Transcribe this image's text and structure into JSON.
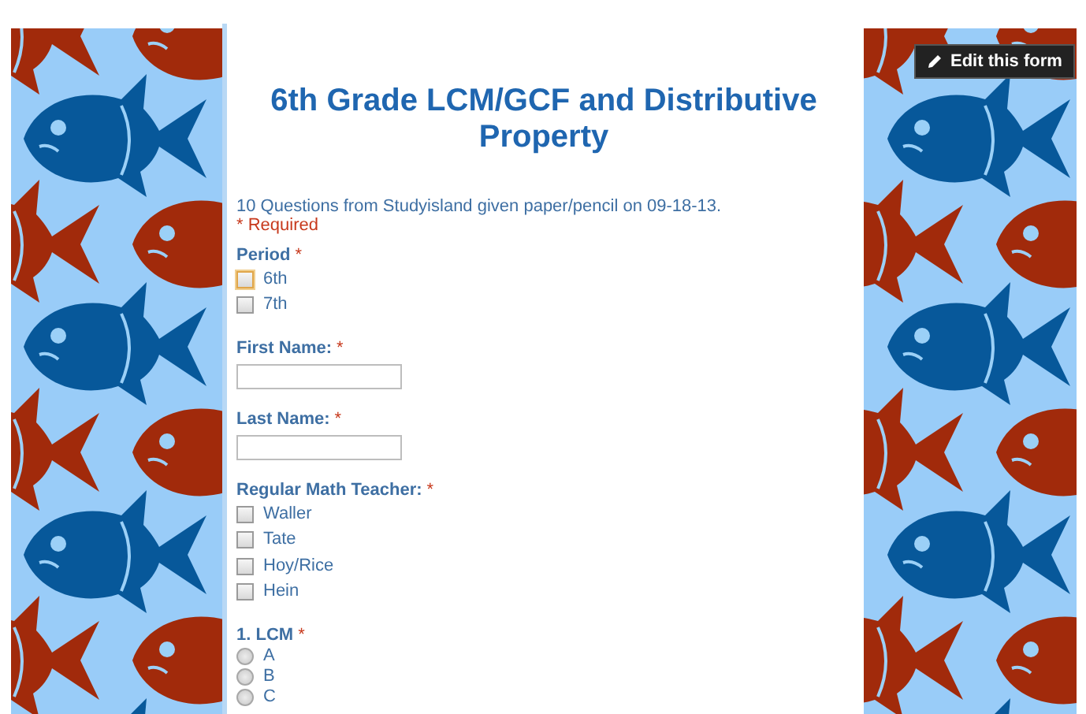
{
  "edit_button": {
    "label": "Edit this form"
  },
  "form": {
    "title": "6th Grade LCM/GCF and Distributive Property",
    "description": "10 Questions from Studyisland given paper/pencil on 09-18-13.",
    "required_note": "* Required",
    "questions": [
      {
        "kind": "checkbox",
        "label": "Period",
        "required_mark": "*",
        "options": [
          {
            "label": "6th",
            "checked": false,
            "focused": true
          },
          {
            "label": "7th",
            "checked": false,
            "focused": false
          }
        ]
      },
      {
        "kind": "text",
        "label": "First Name:",
        "required_mark": "*"
      },
      {
        "kind": "text",
        "label": "Last Name:",
        "required_mark": "*"
      },
      {
        "kind": "checkbox",
        "label": "Regular Math Teacher:",
        "required_mark": "*",
        "options": [
          {
            "label": "Waller",
            "checked": false,
            "focused": false
          },
          {
            "label": "Tate",
            "checked": false,
            "focused": false
          },
          {
            "label": "Hoy/Rice",
            "checked": false,
            "focused": false
          },
          {
            "label": "Hein",
            "checked": false,
            "focused": false
          }
        ]
      },
      {
        "kind": "radio",
        "label": "1. LCM",
        "required_mark": "*",
        "options": [
          {
            "label": "A",
            "selected": false
          },
          {
            "label": "B",
            "selected": false
          },
          {
            "label": "C",
            "selected": false
          }
        ]
      }
    ]
  }
}
